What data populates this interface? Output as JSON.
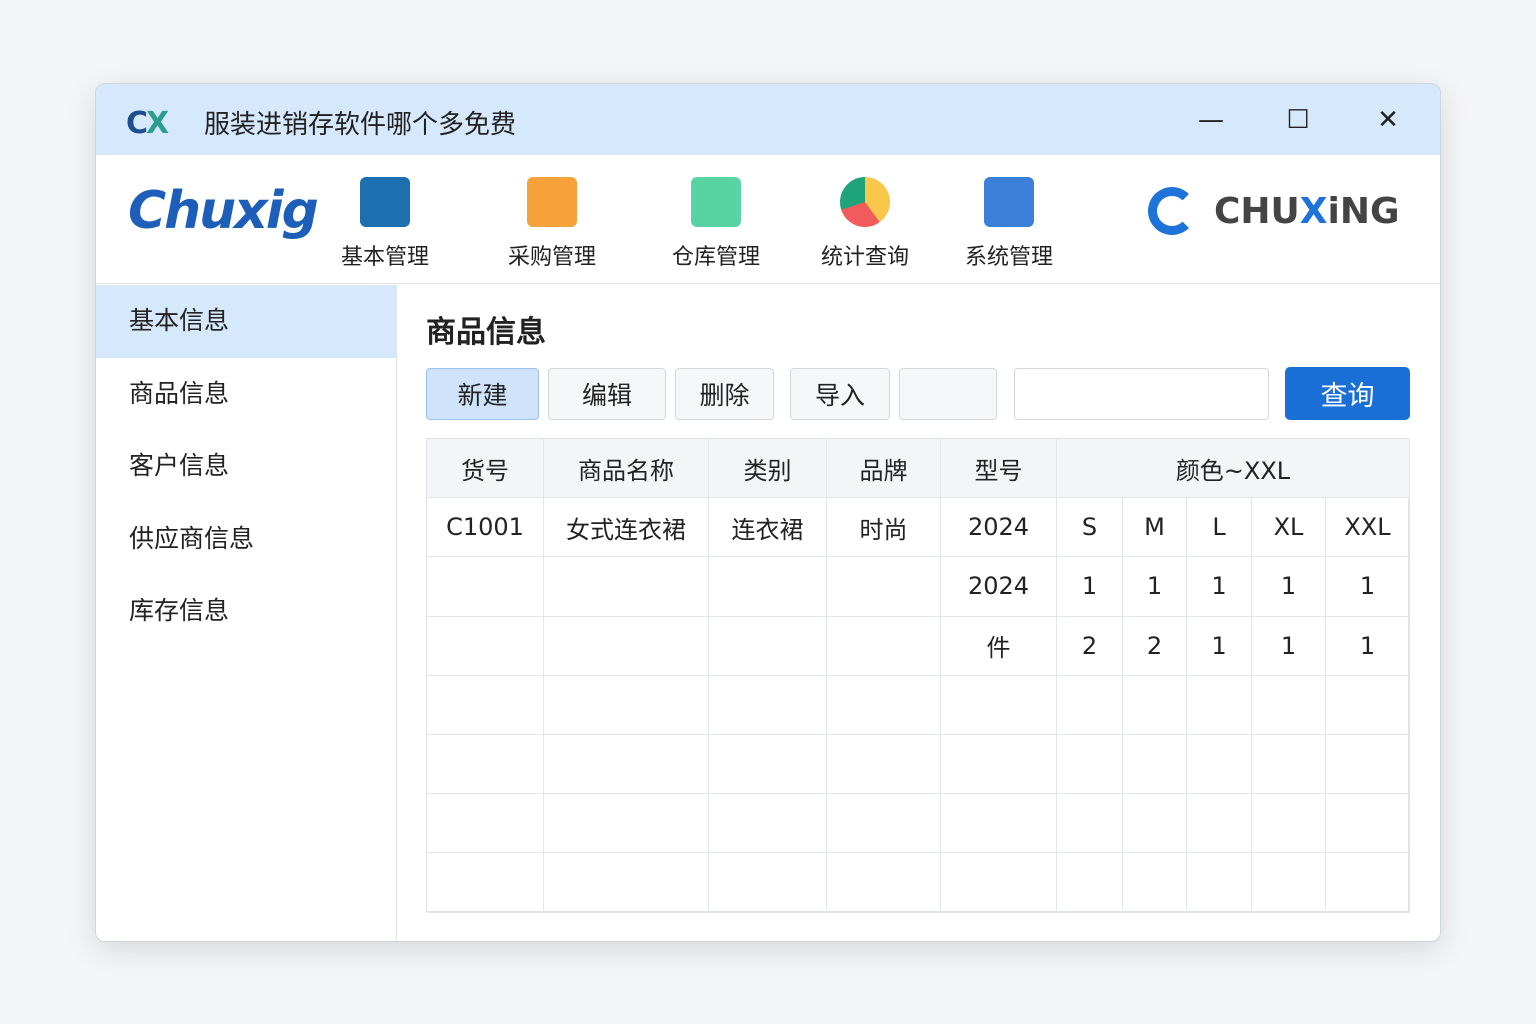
{
  "window": {
    "logo_text": "CX",
    "title": "服装进销存软件哪个多免费",
    "controls": [
      "—",
      "☐",
      "✕"
    ]
  },
  "toolbar": {
    "logo": "Chuxig",
    "brand": {
      "prefix": "CHU",
      "accent": "X",
      "suffix": "iNG"
    },
    "nav": [
      {
        "label": "基本管理",
        "icon": "document-list-icon",
        "color": "#1d6fb0"
      },
      {
        "label": "采购管理",
        "icon": "purchase-icon",
        "color": "#f7a23b"
      },
      {
        "label": "仓库管理",
        "icon": "warehouse-icon",
        "color": "#4fd0a0"
      },
      {
        "label": "统计查询",
        "icon": "pie-chart-icon",
        "color": "#f66"
      },
      {
        "label": "系统管理",
        "icon": "settings-document-icon",
        "color": "#3b80d8"
      }
    ]
  },
  "sidebar": {
    "items": [
      "基本信息",
      "商品信息",
      "客户信息",
      "供应商信息",
      "库存信息"
    ],
    "active": 0
  },
  "main": {
    "title": "商品信息",
    "buttons": {
      "new": "新建",
      "edit": "编辑",
      "delete": "删除",
      "import": "导入",
      "blank": "",
      "query": "查询"
    },
    "search": {
      "value": ""
    },
    "table": {
      "headers": [
        "货号",
        "商品名称",
        "类别",
        "品牌",
        "型号",
        "颜色~XXL"
      ],
      "rows": [
        [
          "C1001",
          "女式连衣裙",
          "连衣裙",
          "时尚",
          "2024",
          "S",
          "M",
          "L",
          "XL",
          "XXL"
        ],
        [
          "",
          "",
          "",
          "",
          "2024",
          "1",
          "1",
          "1",
          "1",
          "1"
        ],
        [
          "",
          "",
          "",
          "",
          "件",
          "2",
          "2",
          "1",
          "1",
          "1"
        ]
      ],
      "empty_rows": 4
    }
  }
}
